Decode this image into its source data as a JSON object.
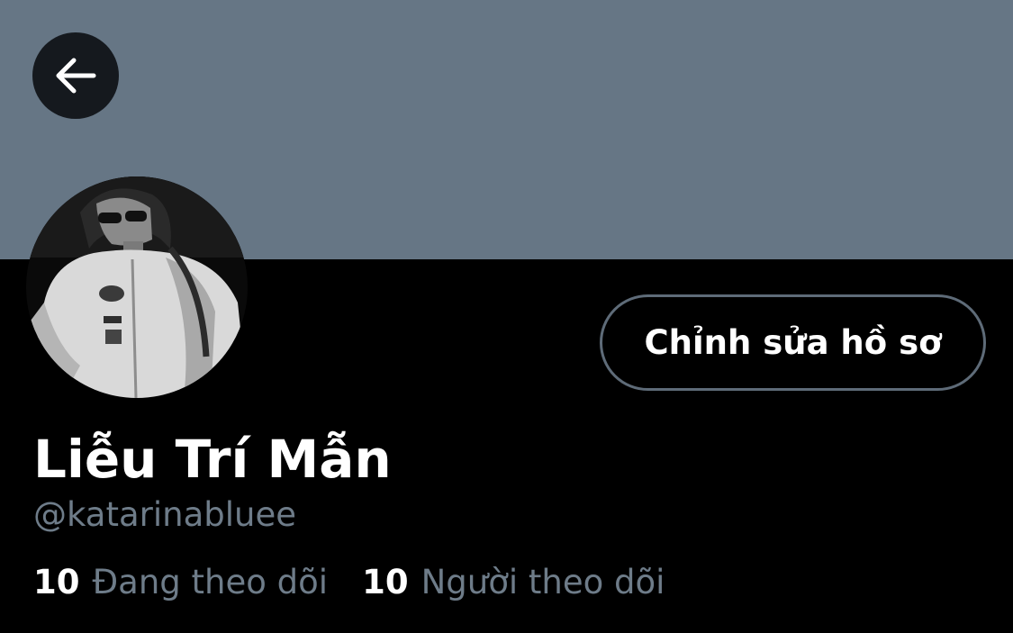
{
  "header": {
    "banner_color": "#667685",
    "back_icon": "arrow-left-icon"
  },
  "profile": {
    "avatar": "black-and-white portrait photo",
    "edit_button_label": "Chỉnh sửa hồ sơ",
    "display_name": "Liễu Trí Mẫn",
    "handle": "@katarinabluee"
  },
  "stats": {
    "following": {
      "count": "10",
      "label": "Đang theo dõi"
    },
    "followers": {
      "count": "10",
      "label": "Người theo dõi"
    }
  },
  "colors": {
    "background": "#000000",
    "text_primary": "#ffffff",
    "text_secondary": "#6e7c89",
    "button_border": "#5e6b78"
  }
}
